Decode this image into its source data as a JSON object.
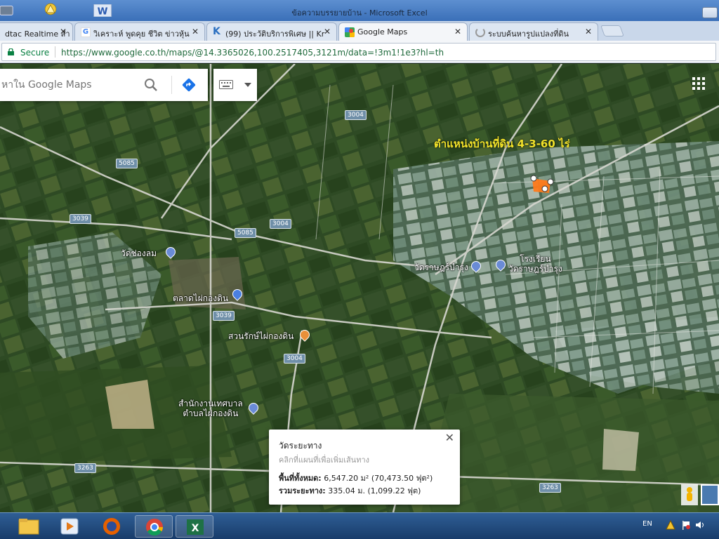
{
  "window": {
    "title": "ข้อความบรรยายบ้าน - Microsoft Excel",
    "icons": [
      "chrome-restore-icon",
      "network-warning-icon",
      "word-icon",
      "maximize-icon"
    ]
  },
  "tabs": [
    {
      "label": "dtac Realtime สำ",
      "icon": "dtac-icon",
      "active": false
    },
    {
      "label": "วิเคราะห์ พูดคุย ชีวิต ข่าวหุ้น",
      "icon": "google-icon",
      "active": false
    },
    {
      "label": "(99) ประวัติบริการพิเศษ || Kr",
      "icon": "k-icon",
      "active": false
    },
    {
      "label": "Google Maps",
      "icon": "google-maps-icon",
      "active": true
    },
    {
      "label": "ระบบค้นหารูปแปลงที่ดิน",
      "icon": "loading-icon",
      "active": false
    }
  ],
  "address_bar": {
    "secure_label": "Secure",
    "url": "https://www.google.co.th/maps/@14.3365026,100.2517405,3121m/data=!3m1!1e3?hl=th"
  },
  "maps": {
    "search_placeholder": "หาใน Google Maps",
    "annotation": "ตำแหน่งบ้านที่ดิน   4-3-60 ไร่",
    "road_shields": [
      "3004",
      "5085",
      "3039",
      "5085",
      "3004",
      "3039",
      "3004",
      "3263",
      "3263"
    ],
    "places": [
      {
        "name": "วัดช่องลม",
        "pin": "#6a8bd6"
      },
      {
        "name": "ตลาดไผ่กองดิน",
        "pin": "#4a7fe0"
      },
      {
        "name": "สวนรักษ์ไผ่กองดิน",
        "pin": "#e8903a"
      },
      {
        "name": "วัดราษฎร์บำรุง",
        "pin": "#6a8bd6"
      },
      {
        "name": "โรงเรียน\nวัดราษฎร์บำรุง",
        "pin": "#6a8bd6"
      },
      {
        "name": "สำนักงานเทศบาล\nตำบลไผ่กองดิน",
        "pin": "#6a8bd6"
      }
    ],
    "measure_card": {
      "title": "วัดระยะทาง",
      "hint": "คลิกที่แผนที่เพื่อเพิ่มเส้นทาง",
      "area_label": "พื้นที่ทั้งหมด:",
      "area_value": " 6,547.20 ม² (70,473.50 ฟุต²)",
      "distance_label": "รวมระยะทาง:",
      "distance_value": " 335.04 ม. (1,099.22 ฟุต)"
    }
  },
  "taskbar": {
    "apps": [
      "folder-icon",
      "media-player-icon",
      "firefox-icon",
      "chrome-icon",
      "excel-icon"
    ],
    "language": "EN"
  }
}
